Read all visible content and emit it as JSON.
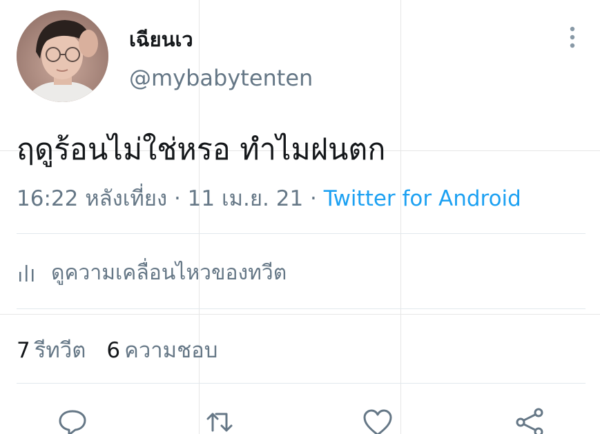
{
  "author": {
    "display_name": "เฉียนเว",
    "handle": "@mybabytenten"
  },
  "tweet": {
    "text": "ฤดูร้อนไม่ใช่หรอ ทำไมฝนตก",
    "time": "16:22 หลังเที่ยง",
    "separator": "·",
    "date": "11 เม.ย. 21",
    "source": "Twitter for Android"
  },
  "activity": {
    "label": "ดูความเคลื่อนไหวของทวีต",
    "icon": "analytics-bars-icon"
  },
  "stats": {
    "retweets_count": "7",
    "retweets_label": "รีทวีต",
    "likes_count": "6",
    "likes_label": "ความชอบ"
  },
  "actions": {
    "icons": [
      "reply-icon",
      "retweet-icon",
      "like-icon",
      "share-icon"
    ]
  },
  "colors": {
    "text": "#14171a",
    "secondary": "#657786",
    "link": "#1da1f2",
    "divider": "#e1e8ed"
  }
}
